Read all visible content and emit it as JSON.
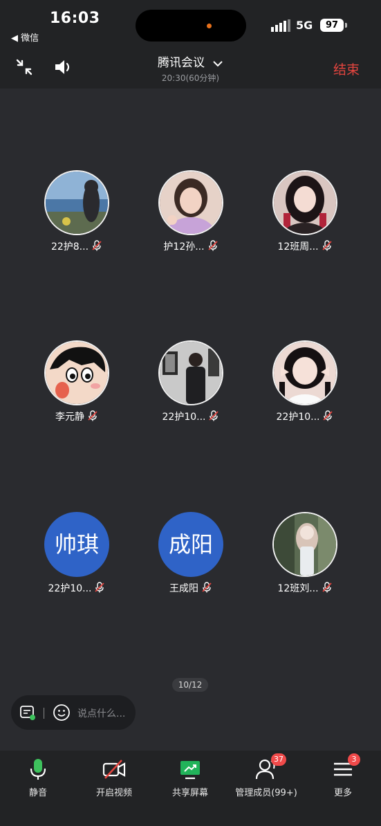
{
  "status_bar": {
    "time": "16:03",
    "back_label": "◀ 微信",
    "network": "5G",
    "battery": "97"
  },
  "header": {
    "title": "腾讯会议",
    "subtitle": "20:30(60分钟)",
    "end_label": "结束"
  },
  "participants": [
    {
      "name": "22护8...",
      "avatar": "photo-sea",
      "muted": true
    },
    {
      "name": "护12孙...",
      "avatar": "photo-girl-pink",
      "muted": true
    },
    {
      "name": "12班周...",
      "avatar": "photo-girl-red",
      "muted": true
    },
    {
      "name": "李元静",
      "avatar": "cartoon-shinchan",
      "muted": true
    },
    {
      "name": "22护10...",
      "avatar": "photo-person-dark",
      "muted": true
    },
    {
      "name": "22护10...",
      "avatar": "photo-girl-peace",
      "muted": true
    },
    {
      "name": "22护10...",
      "avatar_text": "帅琪",
      "muted": true
    },
    {
      "name": "王成阳",
      "avatar_text": "成阳",
      "muted": true
    },
    {
      "name": "12班刘...",
      "avatar": "photo-girl-forest",
      "muted": true
    }
  ],
  "pager": "10/12",
  "chat": {
    "placeholder": "说点什么..."
  },
  "toolbar": {
    "mute_label": "静音",
    "video_label": "开启视频",
    "share_label": "共享屏幕",
    "members_label": "管理成员(99+)",
    "members_badge": "37",
    "more_label": "更多",
    "more_badge": "3"
  },
  "colors": {
    "background": "#2a2b2f",
    "bar": "#222325",
    "end_red": "#e5453f",
    "avatar_blue": "#2f63c7",
    "mic_green": "#3ec25d",
    "share_green": "#22b35a",
    "badge_red": "#f04a4a"
  }
}
